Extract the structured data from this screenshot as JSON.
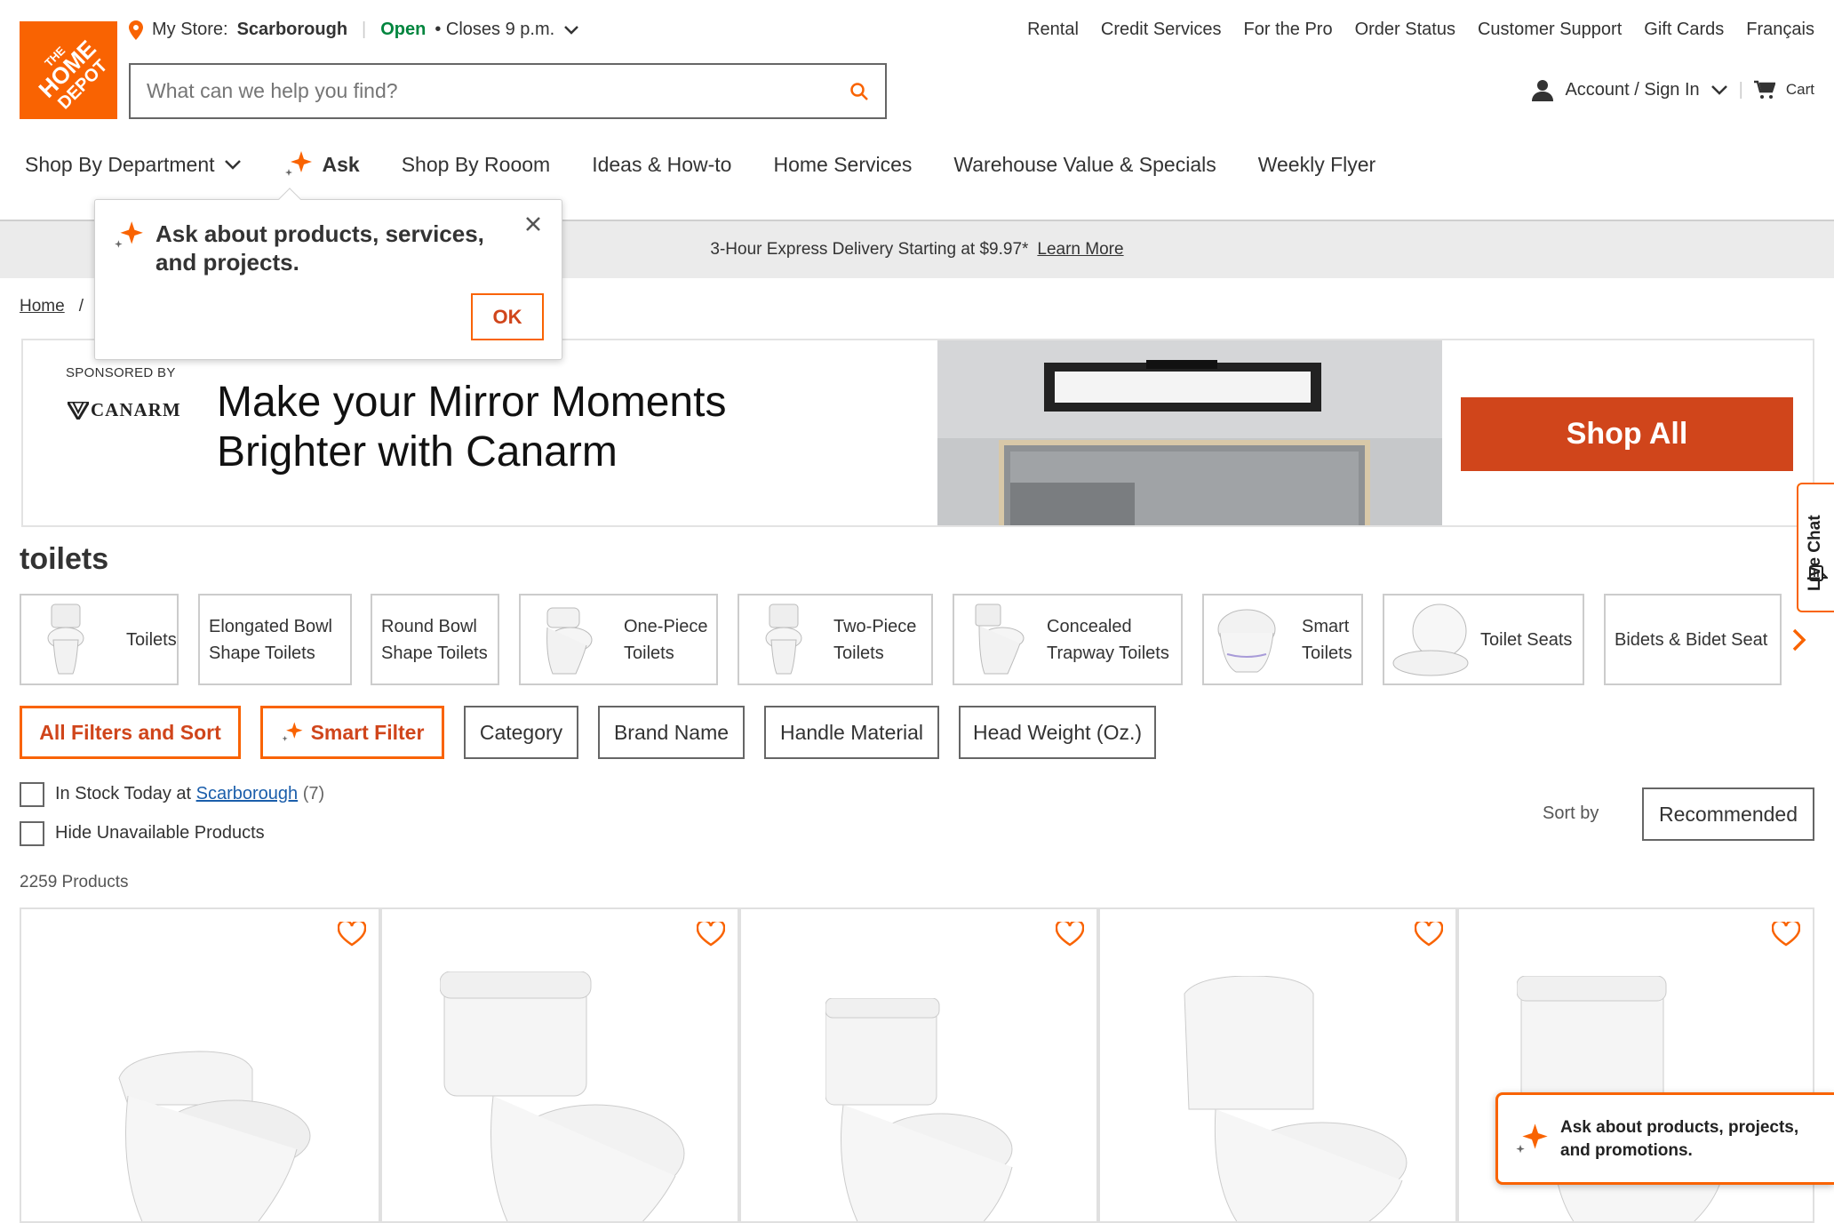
{
  "store": {
    "prefix": "My Store:",
    "name": "Scarborough",
    "open": "Open",
    "hours": "• Closes 9 p.m."
  },
  "top_nav": [
    "Rental",
    "Credit Services",
    "For the Pro",
    "Order Status",
    "Customer Support",
    "Gift Cards",
    "Français"
  ],
  "logo_text": "THE HOME DEPOT",
  "search": {
    "placeholder": "What can we help you find?"
  },
  "account": {
    "label": "Account / Sign In",
    "cart": "Cart"
  },
  "main_nav": {
    "shop_by_department": "Shop By Department",
    "ask": "Ask",
    "shop_by_room": "Shop By Rooom",
    "ideas": "Ideas & How-to",
    "home_services": "Home Services",
    "warehouse": "Warehouse Value & Specials",
    "flyer": "Weekly Flyer"
  },
  "promo": {
    "text": "3-Hour Express Delivery Starting at $9.97*",
    "link": "Learn More"
  },
  "breadcrumb": {
    "home": "Home",
    "sep": "/"
  },
  "popover": {
    "text": "Ask about products, services, and projects.",
    "ok": "OK"
  },
  "ad": {
    "sponsored": "SPONSORED BY",
    "brand": "CANARM",
    "headline": "Make your Mirror Moments Brighter with Canarm",
    "cta": "Shop All"
  },
  "live_chat": "Live Chat",
  "page_title": "toilets",
  "categories": [
    "Toilets",
    "Elongated Bowl Shape Toilets",
    "Round Bowl Shape Toilets",
    "One-Piece Toilets",
    "Two-Piece Toilets",
    "Concealed Trapway Toilets",
    "Smart Toilets",
    "Toilet Seats",
    "Bidets & Bidet Seat"
  ],
  "filters": {
    "all": "All Filters and Sort",
    "smart": "Smart Filter",
    "category": "Category",
    "brand": "Brand Name",
    "handle": "Handle Material",
    "head_weight": "Head Weight (Oz.)"
  },
  "stock": {
    "label": "In Stock Today at",
    "store": "Scarborough",
    "count": "(7)",
    "hide": "Hide Unavailable Products"
  },
  "sort": {
    "label": "Sort by",
    "value": "Recommended"
  },
  "product_count": "2259 Products",
  "chat_widget": "Ask about products, projects, and promotions.",
  "colors": {
    "brand": "#f96302",
    "accent": "#d0451b",
    "open": "#00853e"
  }
}
